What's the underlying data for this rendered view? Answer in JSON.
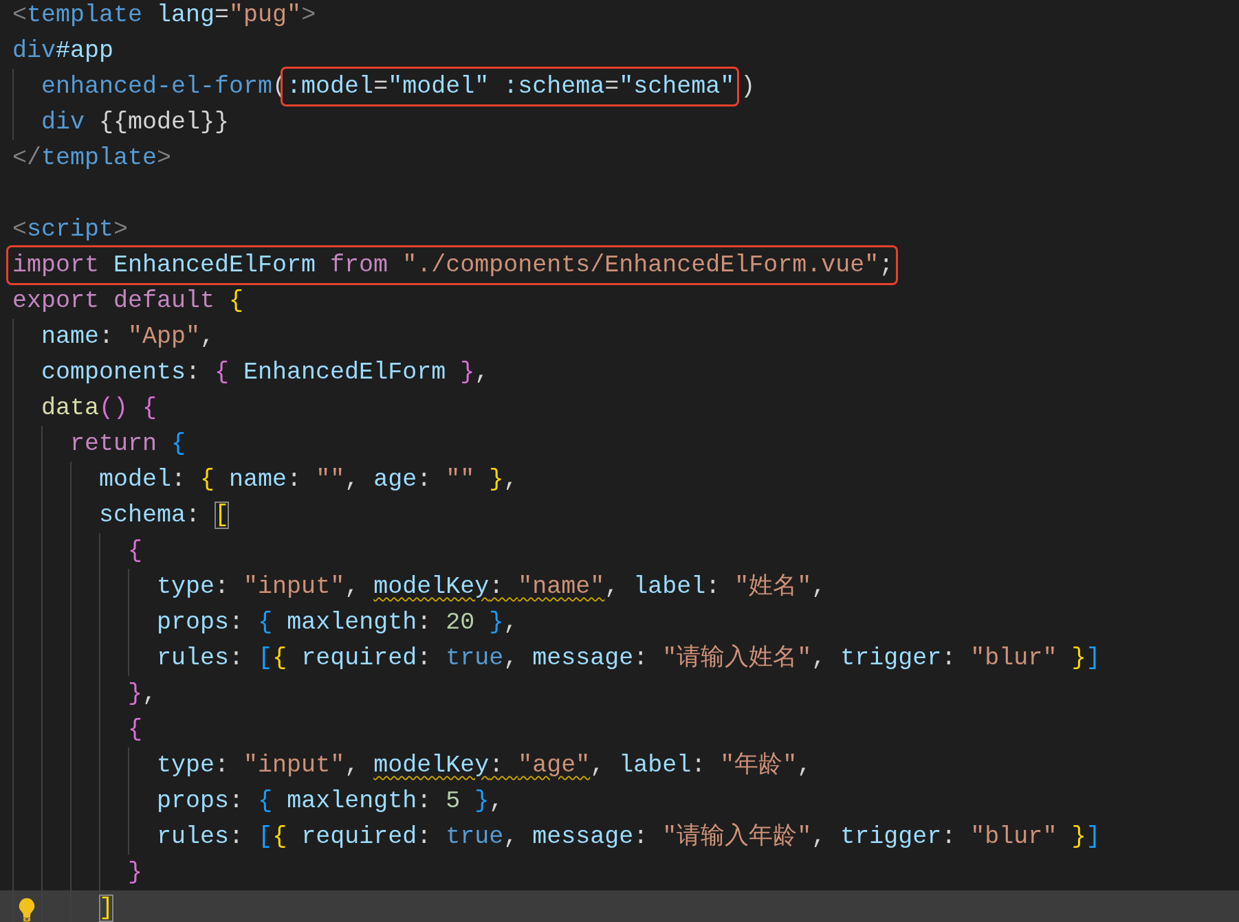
{
  "editor": {
    "sections": [
      {
        "lines": [
          {
            "tokens": [
              {
                "text": "<",
                "kind": "punct"
              },
              {
                "text": "template",
                "kind": "tag"
              },
              {
                "text": " lang",
                "kind": "attr"
              },
              {
                "text": "=",
                "kind": "text"
              },
              {
                "text": "\"pug\"",
                "kind": "str"
              },
              {
                "text": ">",
                "kind": "punct"
              }
            ]
          },
          {
            "tokens": [
              {
                "text": "div",
                "kind": "tag"
              },
              {
                "text": "#app",
                "kind": "attr"
              }
            ]
          },
          {
            "tokens": [
              {
                "text": "  enhanced-el-form",
                "kind": "tag"
              },
              {
                "text": "(",
                "kind": "text"
              },
              {
                "kind": "box",
                "tokens": [
                  {
                    "text": ":model",
                    "kind": "attr"
                  },
                  {
                    "text": "=",
                    "kind": "text"
                  },
                  {
                    "text": "\"model\"",
                    "kind": "attr"
                  },
                  {
                    "text": " :schema",
                    "kind": "attr"
                  },
                  {
                    "text": "=",
                    "kind": "text"
                  },
                  {
                    "text": "\"schema\"",
                    "kind": "attr"
                  }
                ]
              },
              {
                "text": ")",
                "kind": "text"
              }
            ]
          },
          {
            "tokens": [
              {
                "text": "  div",
                "kind": "tag"
              },
              {
                "text": " {{model}}",
                "kind": "text"
              }
            ]
          },
          {
            "tokens": [
              {
                "text": "</",
                "kind": "punct"
              },
              {
                "text": "template",
                "kind": "tag"
              },
              {
                "text": ">",
                "kind": "punct"
              }
            ]
          }
        ]
      },
      {
        "lines": [
          {
            "tokens": [
              {
                "text": "<",
                "kind": "punct"
              },
              {
                "text": "script",
                "kind": "tag"
              },
              {
                "text": ">",
                "kind": "punct"
              }
            ]
          },
          {
            "tokens": [
              {
                "kind": "box",
                "tokens": [
                  {
                    "text": "import",
                    "kind": "kw"
                  },
                  {
                    "text": " EnhancedElForm",
                    "kind": "var"
                  },
                  {
                    "text": " from",
                    "kind": "kw"
                  },
                  {
                    "text": " \"./components/EnhancedElForm.vue\"",
                    "kind": "str"
                  },
                  {
                    "text": ";",
                    "kind": "text"
                  }
                ]
              }
            ]
          },
          {
            "tokens": [
              {
                "text": "export default",
                "kind": "kw"
              },
              {
                "text": " {",
                "kind": "b1"
              }
            ]
          },
          {
            "tokens": [
              {
                "text": "  name",
                "kind": "prop"
              },
              {
                "text": ": ",
                "kind": "text"
              },
              {
                "text": "\"App\"",
                "kind": "str"
              },
              {
                "text": ",",
                "kind": "text"
              }
            ]
          },
          {
            "tokens": [
              {
                "text": "  components",
                "kind": "prop"
              },
              {
                "text": ": ",
                "kind": "text"
              },
              {
                "text": "{",
                "kind": "b2"
              },
              {
                "text": " EnhancedElForm ",
                "kind": "var"
              },
              {
                "text": "}",
                "kind": "b2"
              },
              {
                "text": ",",
                "kind": "text"
              }
            ]
          },
          {
            "tokens": [
              {
                "text": "  data",
                "kind": "fn"
              },
              {
                "text": "()",
                "kind": "b2"
              },
              {
                "text": " {",
                "kind": "b2"
              }
            ]
          },
          {
            "tokens": [
              {
                "text": "    return",
                "kind": "kw"
              },
              {
                "text": " {",
                "kind": "b3"
              }
            ]
          },
          {
            "tokens": [
              {
                "text": "      model",
                "kind": "prop"
              },
              {
                "text": ": ",
                "kind": "text"
              },
              {
                "text": "{",
                "kind": "b1"
              },
              {
                "text": " name",
                "kind": "prop"
              },
              {
                "text": ": ",
                "kind": "text"
              },
              {
                "text": "\"\"",
                "kind": "str"
              },
              {
                "text": ", ",
                "kind": "text"
              },
              {
                "text": "age",
                "kind": "prop"
              },
              {
                "text": ": ",
                "kind": "text"
              },
              {
                "text": "\"\"",
                "kind": "str"
              },
              {
                "text": " }",
                "kind": "b1"
              },
              {
                "text": ",",
                "kind": "text"
              }
            ]
          },
          {
            "tokens": [
              {
                "text": "      schema",
                "kind": "prop"
              },
              {
                "text": ": ",
                "kind": "text"
              },
              {
                "text": "[",
                "kind": "b1",
                "matched": true
              }
            ]
          },
          {
            "tokens": [
              {
                "text": "        {",
                "kind": "b2"
              }
            ]
          },
          {
            "tokens": [
              {
                "text": "          type",
                "kind": "prop"
              },
              {
                "text": ": ",
                "kind": "text"
              },
              {
                "text": "\"input\"",
                "kind": "str"
              },
              {
                "text": ", ",
                "kind": "text"
              },
              {
                "text": "modelKey",
                "kind": "prop",
                "warning": true
              },
              {
                "text": ": ",
                "kind": "text",
                "warning": true
              },
              {
                "text": "\"name\"",
                "kind": "str",
                "warning": true
              },
              {
                "text": ", ",
                "kind": "text"
              },
              {
                "text": "label",
                "kind": "prop"
              },
              {
                "text": ": ",
                "kind": "text"
              },
              {
                "text": "\"姓名\"",
                "kind": "str"
              },
              {
                "text": ",",
                "kind": "text"
              }
            ]
          },
          {
            "tokens": [
              {
                "text": "          props",
                "kind": "prop"
              },
              {
                "text": ": ",
                "kind": "text"
              },
              {
                "text": "{",
                "kind": "b3"
              },
              {
                "text": " maxlength",
                "kind": "prop"
              },
              {
                "text": ": ",
                "kind": "text"
              },
              {
                "text": "20",
                "kind": "num"
              },
              {
                "text": " }",
                "kind": "b3"
              },
              {
                "text": ",",
                "kind": "text"
              }
            ]
          },
          {
            "tokens": [
              {
                "text": "          rules",
                "kind": "prop"
              },
              {
                "text": ": ",
                "kind": "text"
              },
              {
                "text": "[",
                "kind": "b3"
              },
              {
                "text": "{",
                "kind": "b1"
              },
              {
                "text": " required",
                "kind": "prop"
              },
              {
                "text": ": ",
                "kind": "text"
              },
              {
                "text": "true",
                "kind": "const"
              },
              {
                "text": ", ",
                "kind": "text"
              },
              {
                "text": "message",
                "kind": "prop"
              },
              {
                "text": ": ",
                "kind": "text"
              },
              {
                "text": "\"请输入姓名\"",
                "kind": "str"
              },
              {
                "text": ", ",
                "kind": "text"
              },
              {
                "text": "trigger",
                "kind": "prop"
              },
              {
                "text": ": ",
                "kind": "text"
              },
              {
                "text": "\"blur\"",
                "kind": "str"
              },
              {
                "text": " }",
                "kind": "b1"
              },
              {
                "text": "]",
                "kind": "b3"
              }
            ]
          },
          {
            "tokens": [
              {
                "text": "        }",
                "kind": "b2"
              },
              {
                "text": ",",
                "kind": "text"
              }
            ]
          },
          {
            "tokens": [
              {
                "text": "        {",
                "kind": "b2"
              }
            ]
          },
          {
            "tokens": [
              {
                "text": "          type",
                "kind": "prop"
              },
              {
                "text": ": ",
                "kind": "text"
              },
              {
                "text": "\"input\"",
                "kind": "str"
              },
              {
                "text": ", ",
                "kind": "text"
              },
              {
                "text": "modelKey",
                "kind": "prop",
                "warning": true
              },
              {
                "text": ": ",
                "kind": "text",
                "warning": true
              },
              {
                "text": "\"age\"",
                "kind": "str",
                "warning": true
              },
              {
                "text": ", ",
                "kind": "text"
              },
              {
                "text": "label",
                "kind": "prop"
              },
              {
                "text": ": ",
                "kind": "text"
              },
              {
                "text": "\"年龄\"",
                "kind": "str"
              },
              {
                "text": ",",
                "kind": "text"
              }
            ]
          },
          {
            "tokens": [
              {
                "text": "          props",
                "kind": "prop"
              },
              {
                "text": ": ",
                "kind": "text"
              },
              {
                "text": "{",
                "kind": "b3"
              },
              {
                "text": " maxlength",
                "kind": "prop"
              },
              {
                "text": ": ",
                "kind": "text"
              },
              {
                "text": "5",
                "kind": "num"
              },
              {
                "text": " }",
                "kind": "b3"
              },
              {
                "text": ",",
                "kind": "text"
              }
            ]
          },
          {
            "tokens": [
              {
                "text": "          rules",
                "kind": "prop"
              },
              {
                "text": ": ",
                "kind": "text"
              },
              {
                "text": "[",
                "kind": "b3"
              },
              {
                "text": "{",
                "kind": "b1"
              },
              {
                "text": " required",
                "kind": "prop"
              },
              {
                "text": ": ",
                "kind": "text"
              },
              {
                "text": "true",
                "kind": "const"
              },
              {
                "text": ", ",
                "kind": "text"
              },
              {
                "text": "message",
                "kind": "prop"
              },
              {
                "text": ": ",
                "kind": "text"
              },
              {
                "text": "\"请输入年龄\"",
                "kind": "str"
              },
              {
                "text": ", ",
                "kind": "text"
              },
              {
                "text": "trigger",
                "kind": "prop"
              },
              {
                "text": ": ",
                "kind": "text"
              },
              {
                "text": "\"blur\"",
                "kind": "str"
              },
              {
                "text": " }",
                "kind": "b1"
              },
              {
                "text": "]",
                "kind": "b3"
              }
            ]
          },
          {
            "tokens": [
              {
                "text": "        }",
                "kind": "b2"
              }
            ]
          },
          {
            "current": true,
            "tokens": [
              {
                "text": "      ]",
                "kind": "b1",
                "matched": true
              }
            ]
          }
        ]
      }
    ]
  }
}
